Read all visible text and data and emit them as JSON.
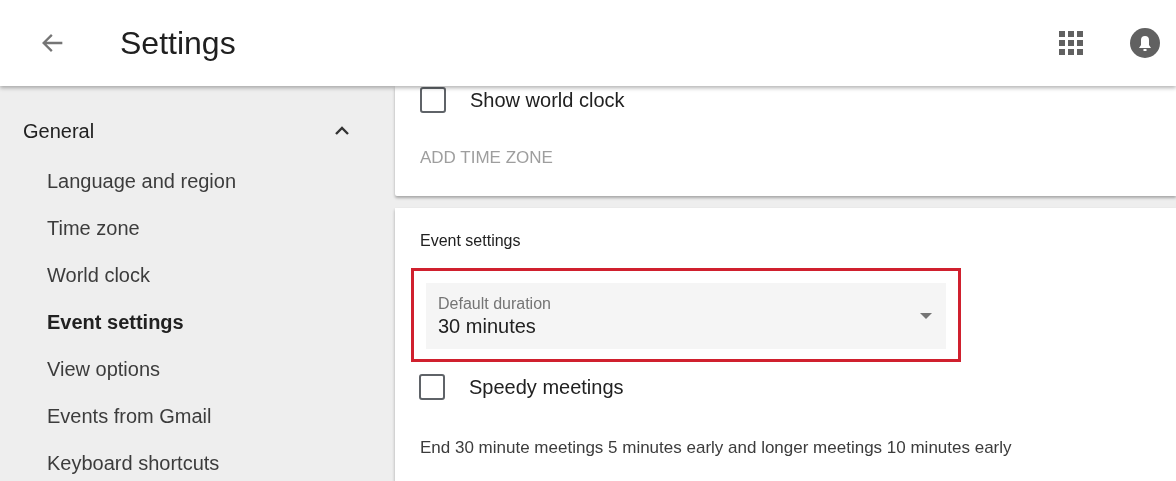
{
  "header": {
    "title": "Settings"
  },
  "sidebar": {
    "section": {
      "label": "General",
      "expanded": true,
      "items": [
        {
          "label": "Language and region",
          "selected": false
        },
        {
          "label": "Time zone",
          "selected": false
        },
        {
          "label": "World clock",
          "selected": false
        },
        {
          "label": "Event settings",
          "selected": true
        },
        {
          "label": "View options",
          "selected": false
        },
        {
          "label": "Events from Gmail",
          "selected": false
        },
        {
          "label": "Keyboard shortcuts",
          "selected": false
        }
      ]
    }
  },
  "world_clock_card": {
    "checkbox": {
      "label": "Show world clock",
      "checked": false
    },
    "add_button": {
      "label": "ADD TIME ZONE",
      "disabled": true
    }
  },
  "event_settings_card": {
    "title": "Event settings",
    "dropdown": {
      "label": "Default duration",
      "value": "30 minutes"
    },
    "checkbox": {
      "label": "Speedy meetings",
      "checked": false
    },
    "description": "End 30 minute meetings 5 minutes early and longer meetings 10 minutes early"
  }
}
